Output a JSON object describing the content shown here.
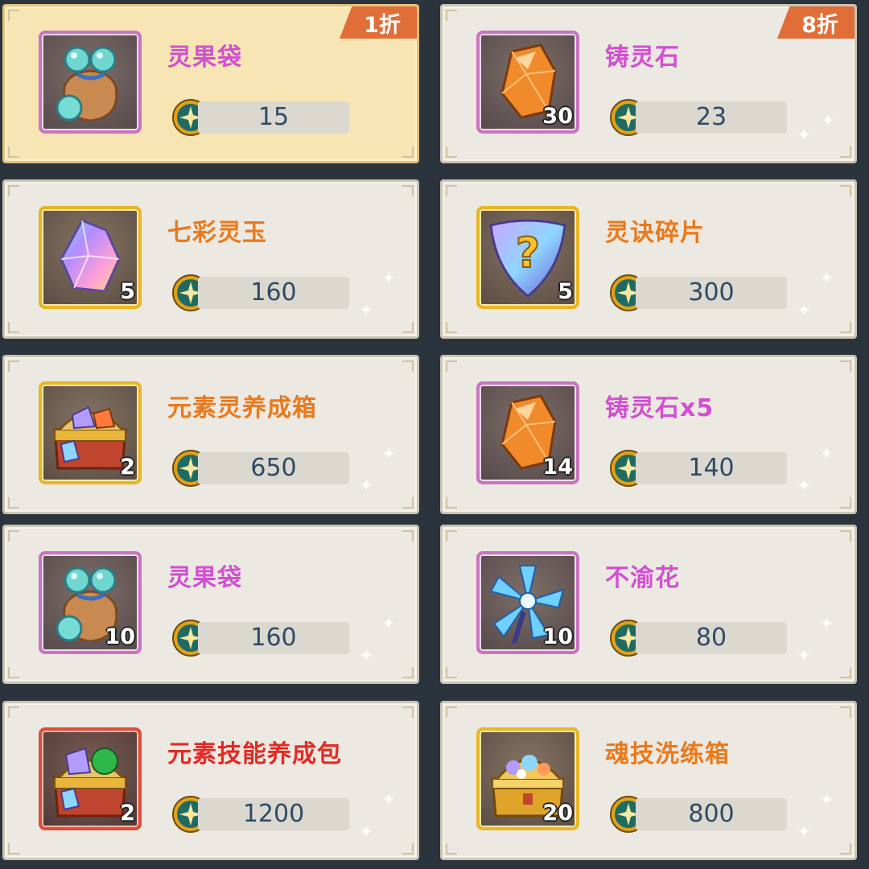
{
  "items": [
    {
      "name": "灵果袋",
      "price": "15",
      "qty": "",
      "discount": "1折",
      "name_color": "purple",
      "frame": "purple",
      "icon": "fruit-bag-icon",
      "highlight": true
    },
    {
      "name": "铸灵石",
      "price": "23",
      "qty": "30",
      "discount": "8折",
      "name_color": "purple",
      "frame": "purple",
      "icon": "spirit-stone-icon",
      "highlight": false
    },
    {
      "name": "七彩灵玉",
      "price": "160",
      "qty": "5",
      "discount": "",
      "name_color": "orange",
      "frame": "gold",
      "icon": "rainbow-jade-icon",
      "highlight": false
    },
    {
      "name": "灵诀碎片",
      "price": "300",
      "qty": "5",
      "discount": "",
      "name_color": "orange",
      "frame": "gold",
      "icon": "mystery-shard-icon",
      "highlight": false
    },
    {
      "name": "元素灵养成箱",
      "price": "650",
      "qty": "2",
      "discount": "",
      "name_color": "orange",
      "frame": "gold",
      "icon": "element-chest-icon",
      "highlight": false
    },
    {
      "name": "铸灵石x5",
      "price": "140",
      "qty": "14",
      "discount": "",
      "name_color": "purple",
      "frame": "purple",
      "icon": "spirit-stone-icon",
      "highlight": false
    },
    {
      "name": "灵果袋",
      "price": "160",
      "qty": "10",
      "discount": "",
      "name_color": "purple",
      "frame": "purple",
      "icon": "fruit-bag-icon",
      "highlight": false
    },
    {
      "name": "不渝花",
      "price": "80",
      "qty": "10",
      "discount": "",
      "name_color": "purple",
      "frame": "purple",
      "icon": "crystal-flower-icon",
      "highlight": false
    },
    {
      "name": "元素技能养成包",
      "price": "1200",
      "qty": "2",
      "discount": "",
      "name_color": "red",
      "frame": "red",
      "icon": "skill-pack-chest-icon",
      "highlight": false
    },
    {
      "name": "魂技洗练箱",
      "price": "800",
      "qty": "20",
      "discount": "",
      "name_color": "orange",
      "frame": "gold",
      "icon": "gold-chest-icon",
      "highlight": false
    }
  ],
  "currency_icon": "star-coin-icon"
}
